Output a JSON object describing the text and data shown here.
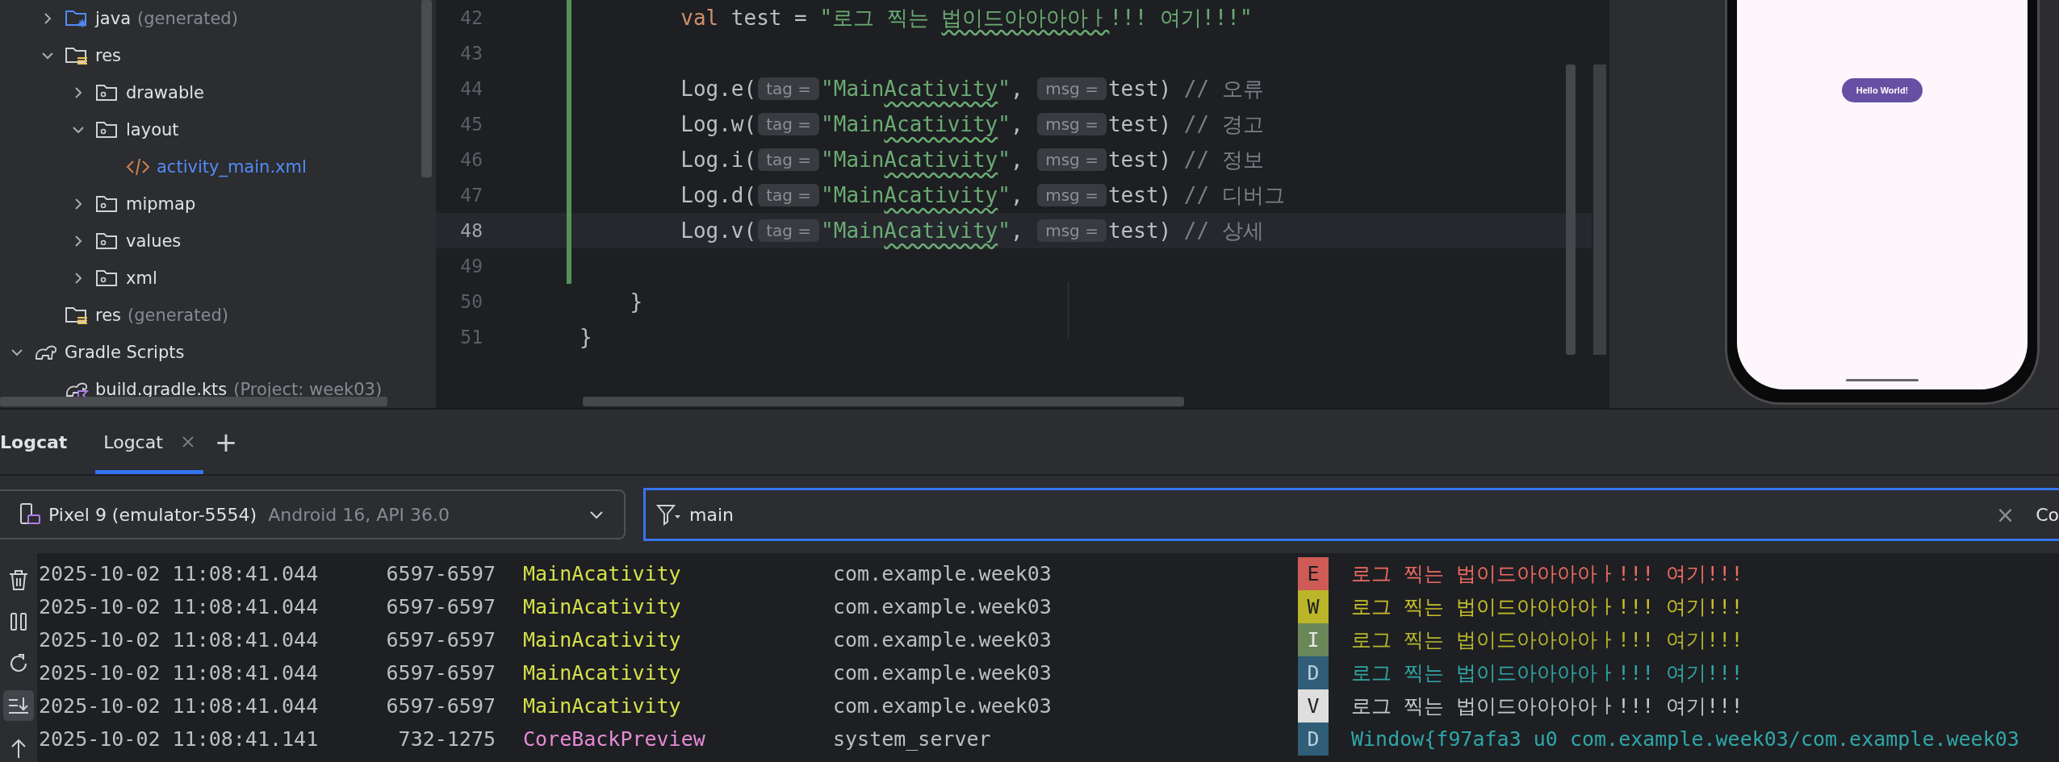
{
  "project_tree": [
    {
      "children": [
        {
          "label": "java",
          "note": "(generated)",
          "kind": "generated-source-folder",
          "expanded": false
        },
        {
          "label": "res",
          "kind": "resource-folder",
          "expanded": true,
          "children": [
            {
              "label": "drawable",
              "kind": "folder",
              "expanded": false
            },
            {
              "label": "layout",
              "kind": "folder",
              "expanded": true,
              "children": [
                {
                  "label": "activity_main.xml",
                  "kind": "xml-file",
                  "changed": true
                }
              ]
            },
            {
              "label": "mipmap",
              "kind": "folder",
              "expanded": false
            },
            {
              "label": "values",
              "kind": "folder",
              "expanded": false
            },
            {
              "label": "xml",
              "kind": "folder",
              "expanded": false
            }
          ]
        },
        {
          "label": "res",
          "note": "(generated)",
          "kind": "resource-folder"
        }
      ]
    },
    {
      "label": "Gradle Scripts",
      "kind": "gradle",
      "expanded": true,
      "children": [
        {
          "label": "build.gradle.kts",
          "note": "(Project: week03)",
          "kind": "gradle-kts-file",
          "changed": false
        }
      ]
    }
  ],
  "editor": {
    "lines": [
      {
        "number": "42",
        "current": false,
        "changed": true,
        "segments": [
          {
            "kind": "code",
            "tokens": [
              {
                "kind": "keyword",
                "text": "        val"
              },
              {
                "kind": "plain",
                "text": " test = "
              },
              {
                "kind": "string",
                "text": "\"로그 찍는 "
              },
              {
                "kind": "string-typo",
                "text": "법이드아아아아ㅏ"
              },
              {
                "kind": "string",
                "text": "!!! 여기!!!\""
              }
            ]
          }
        ]
      },
      {
        "number": "43",
        "current": false,
        "changed": true
      },
      {
        "number": "44",
        "current": false,
        "changed": true,
        "segments": [
          {
            "kind": "code",
            "tokens": [
              {
                "kind": "plain",
                "text": "        Log.e("
              }
            ]
          },
          {
            "kind": "hint",
            "text": "tag ="
          },
          {
            "kind": "code",
            "tokens": [
              {
                "kind": "string",
                "text": "\"Main"
              },
              {
                "kind": "string-typo",
                "text": "Acativity"
              },
              {
                "kind": "string",
                "text": "\""
              },
              {
                "kind": "plain",
                "text": ", "
              }
            ]
          },
          {
            "kind": "hint",
            "text": "msg ="
          },
          {
            "kind": "code",
            "tokens": [
              {
                "kind": "plain",
                "text": "test) "
              },
              {
                "kind": "comment",
                "text": "// 오류"
              }
            ]
          }
        ]
      },
      {
        "number": "45",
        "current": false,
        "changed": true,
        "segments": [
          {
            "kind": "code",
            "tokens": [
              {
                "kind": "plain",
                "text": "        Log.w("
              }
            ]
          },
          {
            "kind": "hint",
            "text": "tag ="
          },
          {
            "kind": "code",
            "tokens": [
              {
                "kind": "string",
                "text": "\"Main"
              },
              {
                "kind": "string-typo",
                "text": "Acativity"
              },
              {
                "kind": "string",
                "text": "\""
              },
              {
                "kind": "plain",
                "text": ", "
              }
            ]
          },
          {
            "kind": "hint",
            "text": "msg ="
          },
          {
            "kind": "code",
            "tokens": [
              {
                "kind": "plain",
                "text": "test) "
              },
              {
                "kind": "comment",
                "text": "// 경고"
              }
            ]
          }
        ]
      },
      {
        "number": "46",
        "current": false,
        "changed": true,
        "segments": [
          {
            "kind": "code",
            "tokens": [
              {
                "kind": "plain",
                "text": "        Log.i("
              }
            ]
          },
          {
            "kind": "hint",
            "text": "tag ="
          },
          {
            "kind": "code",
            "tokens": [
              {
                "kind": "string",
                "text": "\"Main"
              },
              {
                "kind": "string-typo",
                "text": "Acativity"
              },
              {
                "kind": "string",
                "text": "\""
              },
              {
                "kind": "plain",
                "text": ", "
              }
            ]
          },
          {
            "kind": "hint",
            "text": "msg ="
          },
          {
            "kind": "code",
            "tokens": [
              {
                "kind": "plain",
                "text": "test) "
              },
              {
                "kind": "comment",
                "text": "// 정보"
              }
            ]
          }
        ]
      },
      {
        "number": "47",
        "current": false,
        "changed": true,
        "segments": [
          {
            "kind": "code",
            "tokens": [
              {
                "kind": "plain",
                "text": "        Log.d("
              }
            ]
          },
          {
            "kind": "hint",
            "text": "tag ="
          },
          {
            "kind": "code",
            "tokens": [
              {
                "kind": "string",
                "text": "\"Main"
              },
              {
                "kind": "string-typo",
                "text": "Acativity"
              },
              {
                "kind": "string",
                "text": "\""
              },
              {
                "kind": "plain",
                "text": ", "
              }
            ]
          },
          {
            "kind": "hint",
            "text": "msg ="
          },
          {
            "kind": "code",
            "tokens": [
              {
                "kind": "plain",
                "text": "test) "
              },
              {
                "kind": "comment",
                "text": "// 디버그"
              }
            ]
          }
        ]
      },
      {
        "number": "48",
        "current": true,
        "changed": true,
        "segments": [
          {
            "kind": "code",
            "tokens": [
              {
                "kind": "plain",
                "text": "        Log.v("
              }
            ]
          },
          {
            "kind": "hint",
            "text": "tag ="
          },
          {
            "kind": "code",
            "tokens": [
              {
                "kind": "string",
                "text": "\"Main"
              },
              {
                "kind": "string-typo",
                "text": "Acativity"
              },
              {
                "kind": "string",
                "text": "\""
              },
              {
                "kind": "plain",
                "text": ", "
              }
            ]
          },
          {
            "kind": "hint",
            "text": "msg ="
          },
          {
            "kind": "code",
            "tokens": [
              {
                "kind": "plain",
                "text": "test) "
              },
              {
                "kind": "comment",
                "text": "// 상세"
              }
            ]
          }
        ]
      },
      {
        "number": "49",
        "current": false,
        "changed": true
      },
      {
        "number": "50",
        "current": false,
        "changed": false,
        "segments": [
          {
            "kind": "code",
            "tokens": [
              {
                "kind": "plain",
                "text": "    }"
              }
            ]
          }
        ]
      },
      {
        "number": "51",
        "current": false,
        "changed": false,
        "segments": [
          {
            "kind": "code",
            "tokens": [
              {
                "kind": "plain",
                "text": "}"
              }
            ]
          }
        ]
      }
    ]
  },
  "preview": {
    "button_label": "Hello World!"
  },
  "logcat": {
    "panel_title": "Logcat",
    "tabs": [
      {
        "label": "Logcat",
        "selected": true,
        "closable": true
      }
    ],
    "add_tab": "+",
    "device": {
      "name": "Pixel 9 (emulator-5554)",
      "detail": "Android 16, API 36.0"
    },
    "filter": {
      "value": "main",
      "clear": "×"
    },
    "cut_button": "Co",
    "toolbar": [
      {
        "kind": "clear",
        "on": false
      },
      {
        "kind": "pause",
        "on": false
      },
      {
        "kind": "restart",
        "on": false
      },
      {
        "kind": "scroll-end",
        "on": true
      },
      {
        "kind": "up",
        "on": false
      }
    ],
    "rows": [
      {
        "time": "2025-10-02 11:08:41.044",
        "pid": "6597-6597",
        "tag": "MainAcativity",
        "color": "#d5e14a",
        "package": "com.example.week03",
        "level": "E",
        "kind": "error",
        "message": "로그 찍는 법이드아아아아ㅏ!!! 여기!!!"
      },
      {
        "time": "2025-10-02 11:08:41.044",
        "pid": "6597-6597",
        "tag": "MainAcativity",
        "color": "#d5e14a",
        "package": "com.example.week03",
        "level": "W",
        "kind": "warn",
        "message": "로그 찍는 법이드아아아아ㅏ!!! 여기!!!"
      },
      {
        "time": "2025-10-02 11:08:41.044",
        "pid": "6597-6597",
        "tag": "MainAcativity",
        "color": "#d5e14a",
        "package": "com.example.week03",
        "level": "I",
        "kind": "info",
        "message": "로그 찍는 법이드아아아아ㅏ!!! 여기!!!"
      },
      {
        "time": "2025-10-02 11:08:41.044",
        "pid": "6597-6597",
        "tag": "MainAcativity",
        "color": "#d5e14a",
        "package": "com.example.week03",
        "level": "D",
        "kind": "debug",
        "message": "로그 찍는 법이드아아아아ㅏ!!! 여기!!!"
      },
      {
        "time": "2025-10-02 11:08:41.044",
        "pid": "6597-6597",
        "tag": "MainAcativity",
        "color": "#d5e14a",
        "package": "com.example.week03",
        "level": "V",
        "kind": "verbose",
        "message": "로그 찍는 법이드아아아아ㅏ!!! 여기!!!"
      },
      {
        "time": "2025-10-02 11:08:41.141",
        "pid": "732-1275",
        "tag": "CoreBackPreview",
        "color": "#e58bd8",
        "package": "system_server",
        "level": "D",
        "kind": "debug",
        "message": "Window{f97afa3 u0 com.example.week03/com.example.week03"
      }
    ]
  }
}
